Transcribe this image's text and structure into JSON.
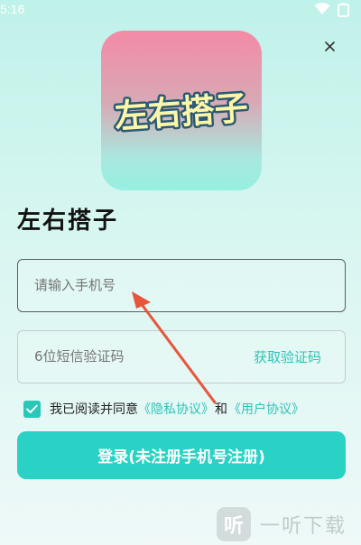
{
  "status_bar": {
    "time": "5:16",
    "icons": [
      "wifi-icon",
      "battery-icon"
    ]
  },
  "close_icon": "close-icon",
  "logo": {
    "text": "左右搭子",
    "colors": [
      "#f48aa6",
      "#96efe1"
    ]
  },
  "app_title": "左右搭子",
  "phone_input": {
    "placeholder": "请输入手机号"
  },
  "code_input": {
    "placeholder": "6位短信验证码",
    "get_code_label": "获取验证码"
  },
  "agreement": {
    "checked": true,
    "prefix": "我已阅读并同意",
    "privacy_link": "《隐私协议》",
    "and": "和",
    "user_link": "《用户协议》"
  },
  "login_button": "登录(未注册手机号注册)",
  "watermark": {
    "badge": "听",
    "text": "一听下载"
  },
  "colors": {
    "accent": "#29d2c4",
    "link": "#2fc4b7",
    "annotation_arrow": "#e8553c"
  }
}
